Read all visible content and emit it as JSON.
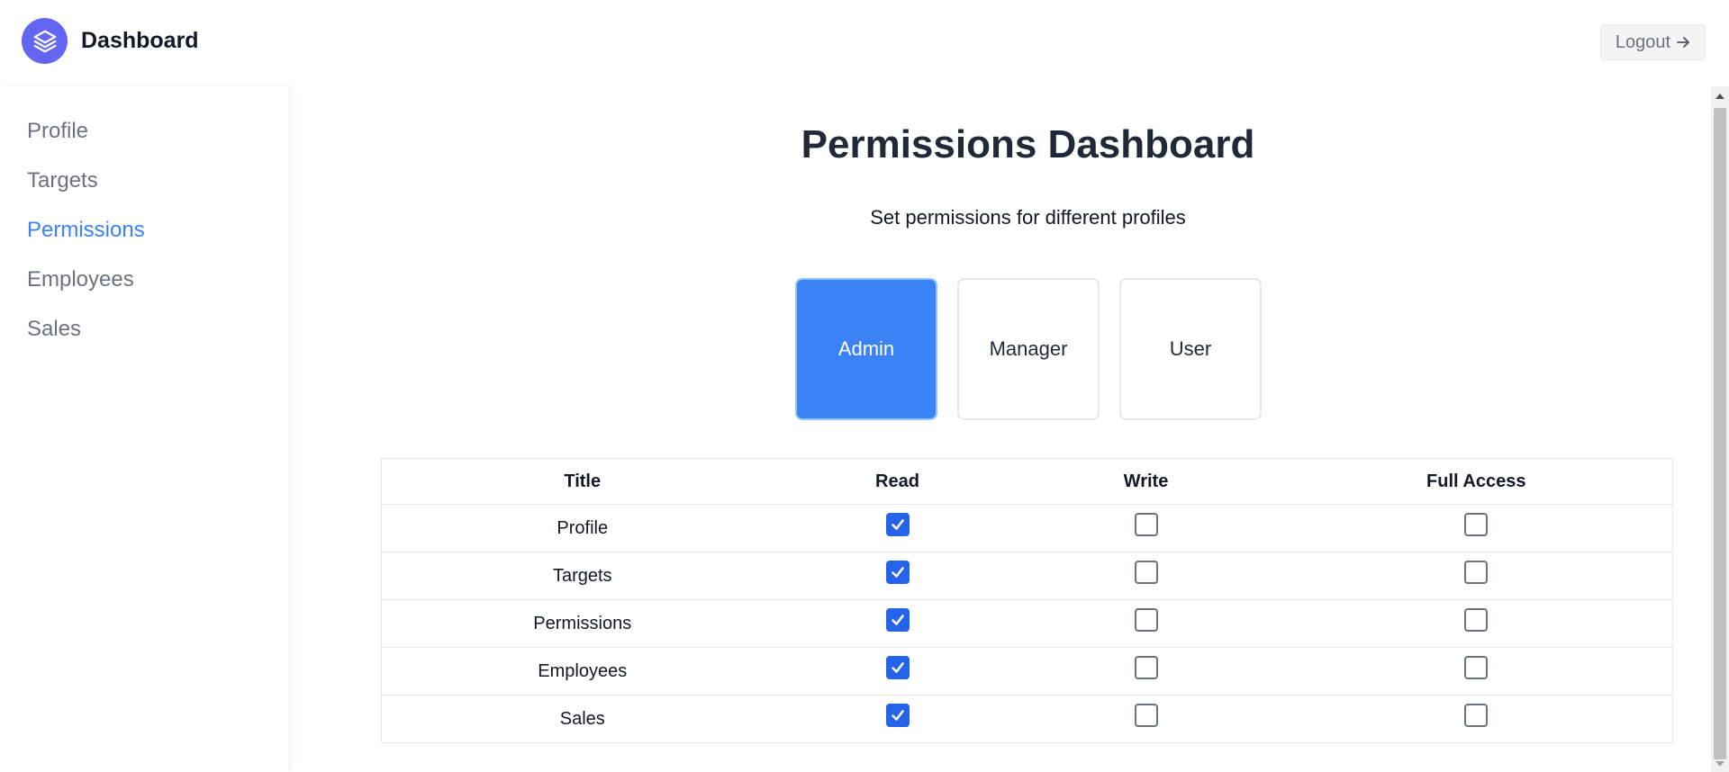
{
  "header": {
    "app_title": "Dashboard",
    "logout_label": "Logout",
    "logo_icon": "layers-icon",
    "accent_color": "#6366f1"
  },
  "sidebar": {
    "items": [
      {
        "label": "Profile",
        "active": false
      },
      {
        "label": "Targets",
        "active": false
      },
      {
        "label": "Permissions",
        "active": true
      },
      {
        "label": "Employees",
        "active": false
      },
      {
        "label": "Sales",
        "active": false
      }
    ],
    "active_color": "#3b82f6"
  },
  "main": {
    "title": "Permissions Dashboard",
    "subtitle": "Set permissions for different profiles",
    "roles": [
      {
        "label": "Admin",
        "selected": true
      },
      {
        "label": "Manager",
        "selected": false
      },
      {
        "label": "User",
        "selected": false
      }
    ],
    "table": {
      "headers": [
        "Title",
        "Read",
        "Write",
        "Full Access"
      ],
      "rows": [
        {
          "title": "Profile",
          "read": true,
          "write": false,
          "full": false
        },
        {
          "title": "Targets",
          "read": true,
          "write": false,
          "full": false
        },
        {
          "title": "Permissions",
          "read": true,
          "write": false,
          "full": false
        },
        {
          "title": "Employees",
          "read": true,
          "write": false,
          "full": false
        },
        {
          "title": "Sales",
          "read": true,
          "write": false,
          "full": false
        }
      ]
    }
  }
}
